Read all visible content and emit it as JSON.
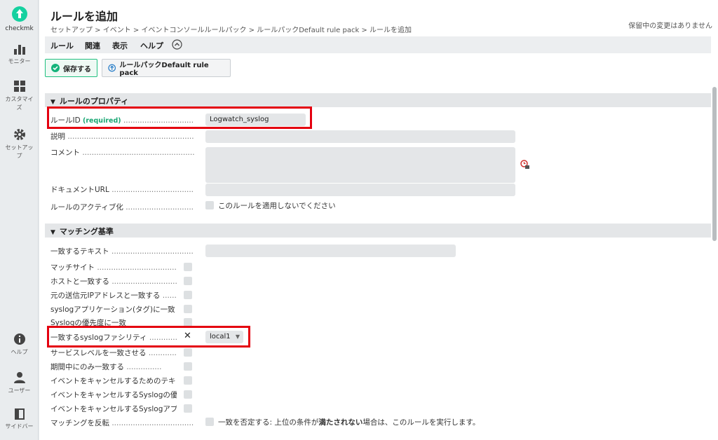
{
  "sidebar": {
    "logo_label": "checkmk",
    "items": [
      {
        "label": "モニター",
        "icon": "monitor-icon"
      },
      {
        "label": "カスタマイズ",
        "icon": "customize-icon"
      },
      {
        "label": "セットアップ",
        "icon": "gear-icon"
      },
      {
        "label": "ヘルプ",
        "icon": "info-icon"
      },
      {
        "label": "ユーザー",
        "icon": "user-icon"
      },
      {
        "label": "サイドバー",
        "icon": "sidebar-icon"
      }
    ]
  },
  "header": {
    "title": "ルールを追加",
    "breadcrumb": "セットアップ > イベント > イベントコンソールルールパック > ルールパックDefault rule pack > ルールを追加",
    "pending": "保留中の変更はありません"
  },
  "menu": [
    "ルール",
    "関連",
    "表示",
    "ヘルプ"
  ],
  "toolbar": {
    "save_label": "保存する",
    "rulepack_label": "ルールパックDefault rule pack"
  },
  "properties": {
    "heading": "ルールのプロパティ",
    "rule_id_label": "ルールID",
    "rule_id_required": "(required)",
    "rule_id_value": "Logwatch_syslog",
    "description_label": "説明",
    "comment_label": "コメント",
    "doc_url_label": "ドキュメントURL",
    "activation_label": "ルールのアクティブ化",
    "activation_checkbox_text": "このルールを適用しないでください"
  },
  "matching": {
    "heading": "マッチング基準",
    "rows": [
      "一致するテキスト",
      "マッチサイト",
      "ホストと一致する",
      "元の送信元IPアドレスと一致する",
      "syslogアプリケーション(タグ)に一致",
      "Syslogの優先度に一致",
      "一致するsyslogファシリティ",
      "サービスレベルを一致させる",
      "期間中にのみ一致する",
      "イベントをキャンセルするためのテキ",
      "イベントをキャンセルするSyslogの優",
      "イベントをキャンセルするSyslogアプ",
      "マッチングを反転"
    ],
    "facility_value": "local1",
    "invert_text_pre": "一致を否定する: 上位の条件が",
    "invert_text_bold": "満たされない",
    "invert_text_post": "場合は、このルールを実行します。"
  }
}
